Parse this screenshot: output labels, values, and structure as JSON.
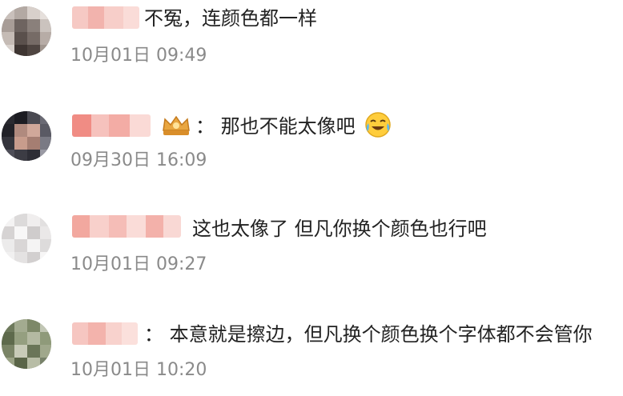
{
  "comments": [
    {
      "text": "不冤，连颜色都一样",
      "time": "10月01日 09:49"
    },
    {
      "text": "：  那也不能太像吧",
      "time": "09月30日 16:09",
      "badge": "crown-badge-icon",
      "emoji": "crying-laughing-emoji"
    },
    {
      "text": "这也太像了 但凡你换个颜色也行吧",
      "time": "10月01日 09:27"
    },
    {
      "text": "：  本意就是擦边，但凡换个颜色换个字体都不会管你",
      "time": "10月01日 10:20"
    }
  ],
  "colors": {
    "text": "#222222",
    "timestamp": "#8a8a8a",
    "username_blur": "#f4b8b3"
  }
}
